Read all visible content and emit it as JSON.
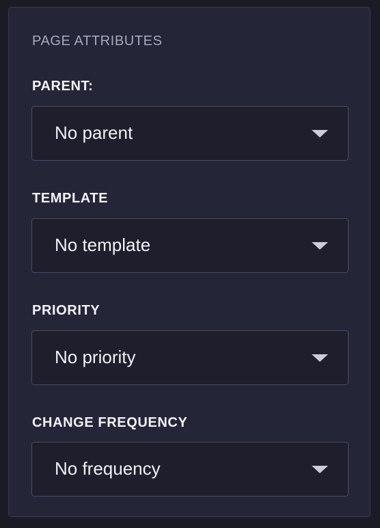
{
  "panel": {
    "title": "PAGE ATTRIBUTES"
  },
  "fields": [
    {
      "label": "PARENT:",
      "value": "No parent",
      "icon": "caret-down-icon"
    },
    {
      "label": "TEMPLATE",
      "value": "No template",
      "icon": "caret-down-icon"
    },
    {
      "label": "PRIORITY",
      "value": "No priority",
      "icon": "caret-down-icon"
    },
    {
      "label": "CHANGE FREQUENCY",
      "value": "No frequency",
      "icon": "caret-down-icon"
    }
  ],
  "colors": {
    "background": "#1b1b26",
    "panel": "#252538",
    "select": "#1e1e2c",
    "border": "#4b4b63",
    "text": "#f2f2f7",
    "muted": "#a7a7be"
  }
}
